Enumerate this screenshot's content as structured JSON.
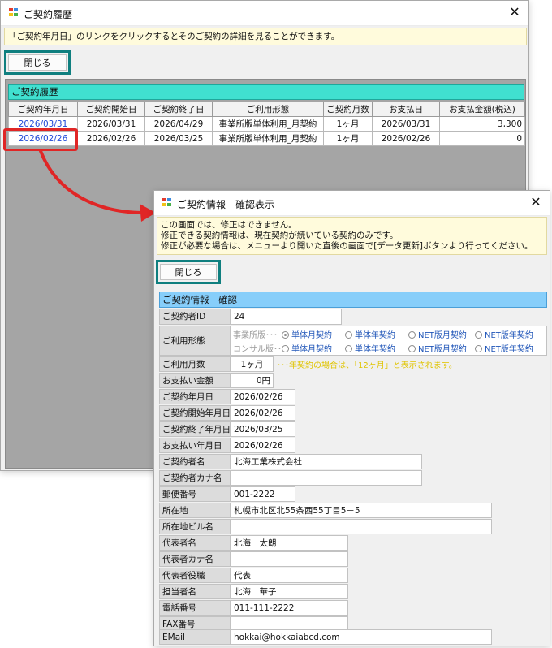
{
  "history_window": {
    "title": "ご契約履歴",
    "notice": "「ご契約年月日」のリンクをクリックするとそのご契約の詳細を見ることができます。",
    "close_label": "閉じる",
    "section_title": "ご契約履歴",
    "columns": [
      "ご契約年月日",
      "ご契約開始日",
      "ご契約終了日",
      "ご利用形態",
      "ご契約月数",
      "お支払日",
      "お支払金額(税込)"
    ],
    "rows": [
      [
        "2026/03/31",
        "2026/03/31",
        "2026/04/29",
        "事業所版単体利用_月契約",
        "1ヶ月",
        "2026/03/31",
        "3,300"
      ],
      [
        "2026/02/26",
        "2026/02/26",
        "2026/03/25",
        "事業所版単体利用_月契約",
        "1ヶ月",
        "2026/02/26",
        "0"
      ]
    ]
  },
  "detail_window": {
    "title": "ご契約情報　確認表示",
    "notice_lines": [
      "この画面では、修正はできません。",
      "修正できる契約情報は、現在契約が続いている契約のみです。",
      "修正が必要な場合は、メニューより開いた直後の画面で[データ更新]ボタンより行ってください。"
    ],
    "close_label": "閉じる",
    "section_title": "ご契約情報　確認",
    "contract_id": {
      "label": "ご契約者ID",
      "value": "24"
    },
    "usage_type": {
      "label": "ご利用形態",
      "row1_label": "事業所版･･･",
      "row2_label": "コンサル版･･･",
      "options": [
        "単体月契約",
        "単体年契約",
        "NET版月契約",
        "NET版年契約"
      ],
      "selected": "単体月契約"
    },
    "months": {
      "label": "ご利用月数",
      "value": "1ヶ月",
      "note": "･･･年契約の場合は、「12ヶ月」と表示されます。"
    },
    "amount": {
      "label": "お支払い金額",
      "value": "0円"
    },
    "contract_date": {
      "label": "ご契約年月日",
      "value": "2026/02/26"
    },
    "start_date": {
      "label": "ご契約開始年月日",
      "value": "2026/02/26"
    },
    "end_date": {
      "label": "ご契約終了年月日",
      "value": "2026/03/25"
    },
    "pay_date": {
      "label": "お支払い年月日",
      "value": "2026/02/26"
    },
    "name": {
      "label": "ご契約者名",
      "value": "北海工業株式会社"
    },
    "name_kana": {
      "label": "ご契約者カナ名",
      "value": ""
    },
    "zip": {
      "label": "郵便番号",
      "value": "001-2222"
    },
    "address": {
      "label": "所在地",
      "value": "札幌市北区北55条西55丁目5－5"
    },
    "building": {
      "label": "所在地ビル名",
      "value": ""
    },
    "rep_name": {
      "label": "代表者名",
      "value": "北海　太朗"
    },
    "rep_kana": {
      "label": "代表者カナ名",
      "value": ""
    },
    "rep_title": {
      "label": "代表者役職",
      "value": "代表"
    },
    "contact": {
      "label": "担当者名",
      "value": "北海　華子"
    },
    "phone": {
      "label": "電話番号",
      "value": "011-111-2222"
    },
    "fax": {
      "label": "FAX番号",
      "value": ""
    },
    "email": {
      "label": "EMail",
      "value": "hokkai@hokkaiabcd.com"
    }
  },
  "colors": {
    "accent_teal": "#0f7f7f",
    "section_cyan": "#40e0d0",
    "section_blue": "#87cefa",
    "callout_red": "#e02626",
    "link_blue": "#1f49d8",
    "notice_yellow": "#fffbdc"
  }
}
